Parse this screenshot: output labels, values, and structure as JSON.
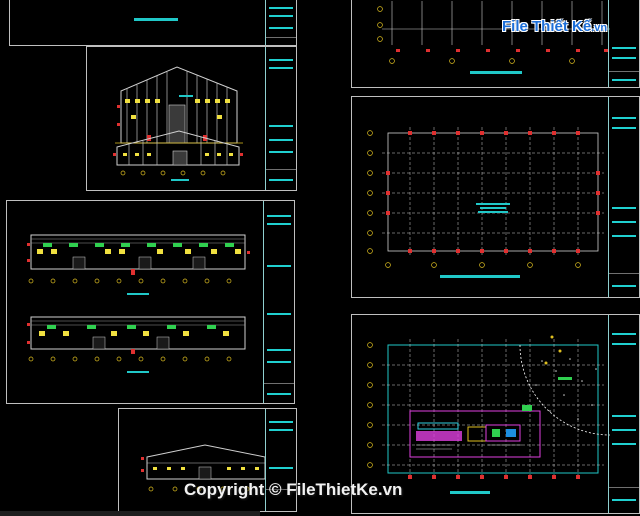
{
  "watermark": {
    "logo_text": "File Thiết Kế",
    "logo_suffix": ".vn",
    "copyright": "Copyright © FileThietKe.vn"
  },
  "drawing_sheets": [
    {
      "name": "top-left-sheet",
      "content": "partial elevation"
    },
    {
      "name": "gable-elevations-sheet",
      "content": "two gable end elevations"
    },
    {
      "name": "long-elevations-sheet",
      "content": "two side elevations"
    },
    {
      "name": "bottom-elevation-sheet",
      "content": "single side elevation"
    },
    {
      "name": "top-right-sheet",
      "content": "partial plan"
    },
    {
      "name": "column-grid-plan-sheet",
      "content": "column grid plan"
    },
    {
      "name": "site-plan-sheet",
      "content": "site plan with detail"
    }
  ],
  "colors": {
    "background": "#000000",
    "frame": "#bfbfbf",
    "cyan": "#20c8c8",
    "grid": "#ffffff",
    "marker": "#e03030",
    "axis_bubble": "#e0c020",
    "window": "#f0e040",
    "green": "#30d050",
    "magenta": "#e040e0",
    "logo_blue": "#1d6fd8"
  }
}
